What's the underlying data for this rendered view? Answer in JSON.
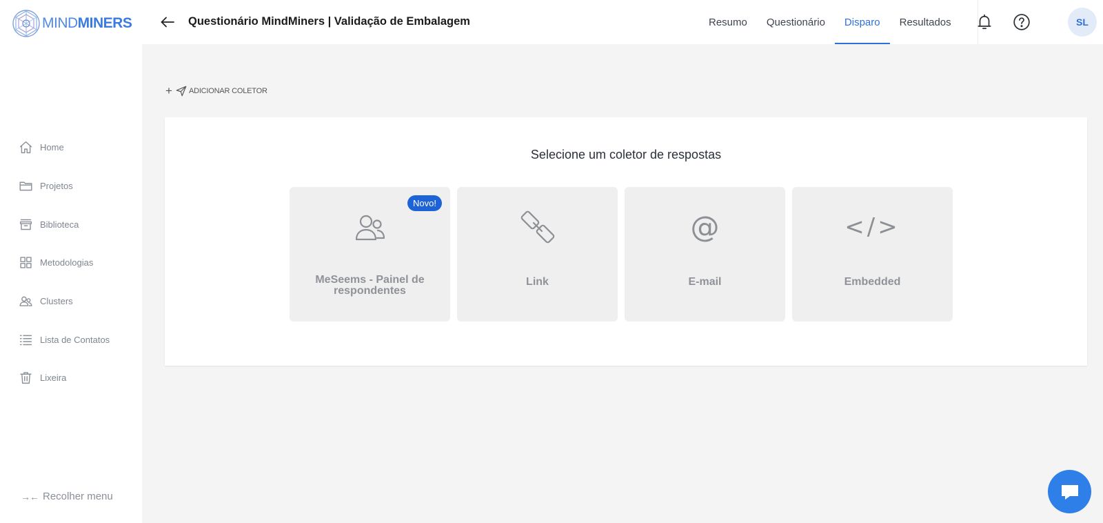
{
  "brand": {
    "name_light": "MIND",
    "name_bold": "MINERS"
  },
  "header": {
    "title": "Questionário MindMiners | Validação de Embalagem",
    "tabs": [
      {
        "label": "Resumo",
        "active": false
      },
      {
        "label": "Questionário",
        "active": false
      },
      {
        "label": "Disparo",
        "active": true
      },
      {
        "label": "Resultados",
        "active": false
      }
    ],
    "avatar_initials": "SL"
  },
  "sidebar": {
    "items": [
      {
        "label": "Home",
        "icon": "home-icon"
      },
      {
        "label": "Projetos",
        "icon": "folder-icon"
      },
      {
        "label": "Biblioteca",
        "icon": "archive-icon"
      },
      {
        "label": "Metodologias",
        "icon": "grid-icon"
      },
      {
        "label": "Clusters",
        "icon": "users-icon"
      },
      {
        "label": "Lista de Contatos",
        "icon": "list-icon"
      },
      {
        "label": "Lixeira",
        "icon": "trash-icon"
      }
    ],
    "collapse_label": "Recolher menu"
  },
  "add_collector": {
    "label": "ADICIONAR COLETOR"
  },
  "collector_panel": {
    "title": "Selecione um coletor de respostas",
    "options": [
      {
        "label": "MeSeems - Painel de respondentes",
        "icon": "users-icon",
        "badge": "Novo!"
      },
      {
        "label": "Link",
        "icon": "link-icon"
      },
      {
        "label": "E-mail",
        "icon": "at-icon",
        "glyph": "@"
      },
      {
        "label": "Embedded",
        "icon": "code-icon",
        "glyph": "</>"
      }
    ]
  },
  "colors": {
    "accent": "#2e6fdb",
    "chat": "#2f7fe8",
    "badge": "#1d63d6"
  }
}
